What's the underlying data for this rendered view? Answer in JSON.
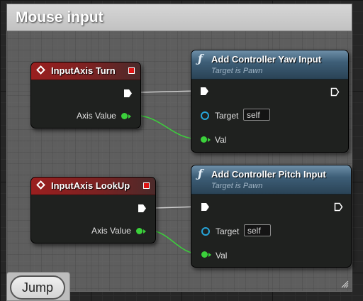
{
  "comment": {
    "title": "Mouse input"
  },
  "nodes": {
    "turn_event": {
      "title": "InputAxis Turn",
      "axis_value_label": "Axis Value"
    },
    "lookup_event": {
      "title": "InputAxis LookUp",
      "axis_value_label": "Axis Value"
    },
    "yaw_func": {
      "icon": "ƒ",
      "title": "Add Controller Yaw Input",
      "subtitle": "Target is Pawn",
      "target_label": "Target",
      "target_value": "self",
      "val_label": "Val"
    },
    "pitch_func": {
      "icon": "ƒ",
      "title": "Add Controller Pitch Input",
      "subtitle": "Target is Pawn",
      "target_label": "Target",
      "target_value": "self",
      "val_label": "Val"
    }
  },
  "tab": {
    "label": "Jump"
  },
  "colors": {
    "event_header": "#9a1f1f",
    "function_header": "#3e5f78",
    "float_pin": "#3bd13b",
    "object_pin": "#26a4d9",
    "exec_wire": "#ffffff"
  }
}
